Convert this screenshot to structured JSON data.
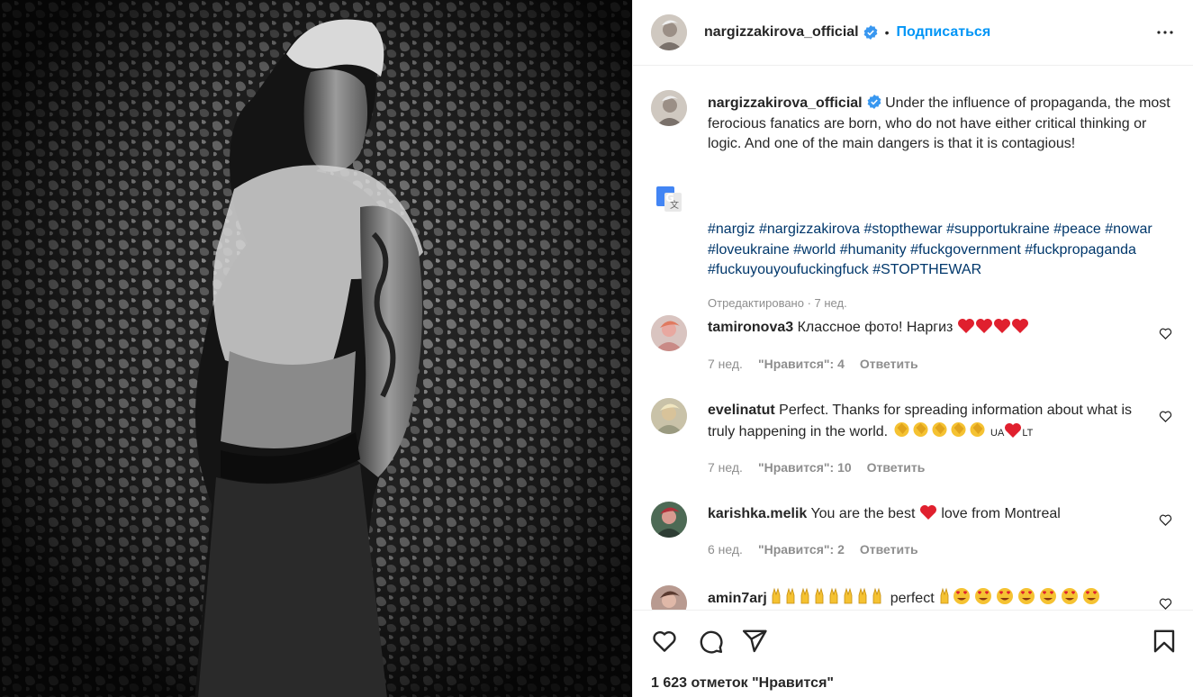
{
  "post": {
    "username": "nargizzakirova_official",
    "dot": "•",
    "follow_label": "Подписаться",
    "caption_text": "Under the influence of propaganda, the most ferocious fanatics are born, who do not have either critical thinking or logic. And one of the main dangers is that it is contagious!",
    "hashtags": [
      "#nargiz",
      "#nargizzakirova",
      "#stopthewar",
      "#supportukraine",
      "#peace",
      "#nowar",
      "#loveukraine",
      "#world",
      "#humanity",
      "#fuckgovernment",
      "#fuckpropaganda",
      "#fuckuyouyoufuckingfuck",
      "#STOPTHEWAR"
    ],
    "edited": "Отредактировано · 7 нед.",
    "likes": "1 623 отметок \"Нравится\""
  },
  "comments": [
    {
      "username": "tamironova3",
      "text": "Классное фото! Наргиз",
      "time": "7 нед.",
      "likes": "\"Нравится\": 4",
      "reply": "Ответить"
    },
    {
      "username": "evelinatut",
      "text": "Perfect. Thanks for spreading information about what is truly happening in the world.",
      "flag_left": "UA",
      "flag_right": "LT",
      "time": "7 нед.",
      "likes": "\"Нравится\": 10",
      "reply": "Ответить"
    },
    {
      "username": "karishka.melik",
      "text_before": "You are the best",
      "text_after": "love from Montreal",
      "time": "6 нед.",
      "likes": "\"Нравится\": 2",
      "reply": "Ответить"
    },
    {
      "username": "amin7arj",
      "text": "perfect"
    }
  ],
  "icons": [
    "more-icon",
    "verified-icon",
    "translate-icon",
    "heart-icon",
    "comment-icon",
    "share-icon",
    "bookmark-icon",
    "red-heart-emoji",
    "clapping-hands-emoji",
    "horns-emoji",
    "heart-eyes-emoji"
  ],
  "colors": {
    "link": "#0095f6",
    "hashtag": "#00376b",
    "muted": "#8e8e8e",
    "red_heart": "#e0202e",
    "verified": "#3897f0"
  }
}
